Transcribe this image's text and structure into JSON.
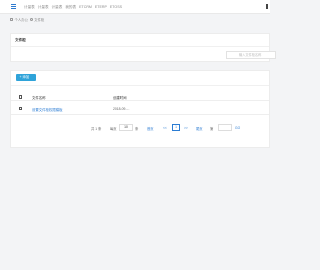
{
  "topnav": {
    "items": [
      "计量表",
      "计量表",
      "计量表",
      "我的表",
      "ETCRM",
      "ETERP",
      "ETOSS"
    ]
  },
  "breadcrumb": {
    "items": [
      "个人办公",
      "文件柜"
    ]
  },
  "filter_panel": {
    "title": "文件柜",
    "search_placeholder": "输入文件柜名称"
  },
  "list_panel": {
    "add_button": "+ 添加",
    "columns": [
      "文件名称",
      "创建时间"
    ],
    "rows": [
      {
        "name": "设置文件柜权限模板",
        "date": "2018-09-..."
      }
    ]
  },
  "pagination": {
    "total": "共 1 条",
    "per_page_label": "每页",
    "per_page": "10",
    "per_page_unit": "条",
    "first": "首页",
    "prev": "<<",
    "current": "1",
    "next": ">>",
    "last": "尾页",
    "goto_label": "第",
    "goto_value": "",
    "goto_button": "GO"
  }
}
